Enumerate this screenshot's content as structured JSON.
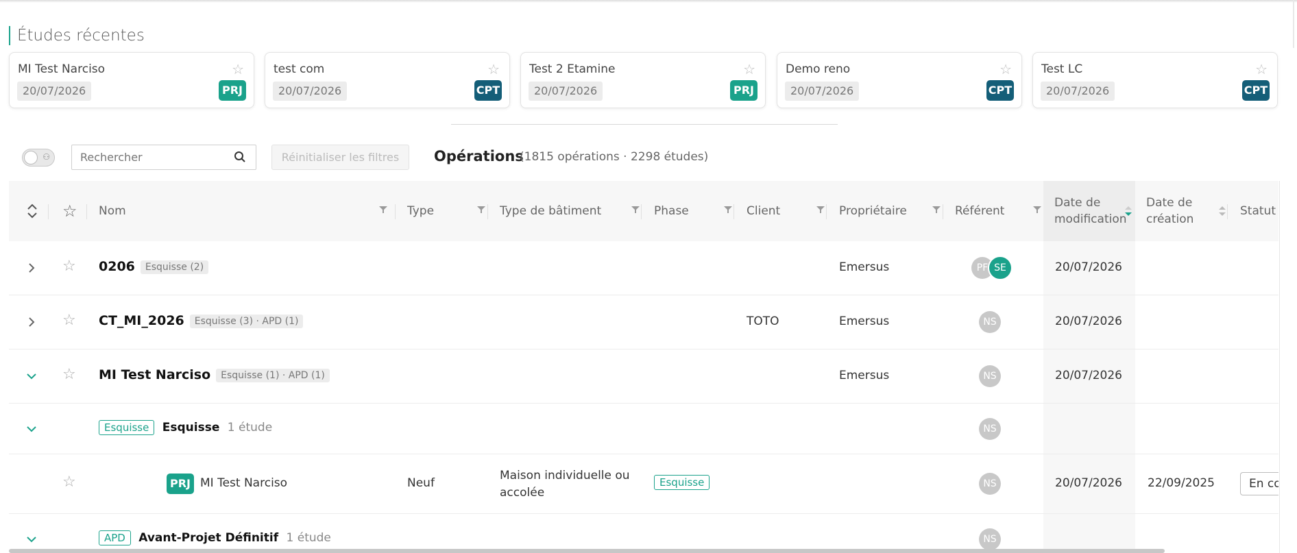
{
  "recent": {
    "title": "Études récentes",
    "cards": [
      {
        "name": "MI Test Narciso",
        "date": "20/07/2026",
        "badge": "PRJ"
      },
      {
        "name": "test com",
        "date": "20/07/2026",
        "badge": "CPT"
      },
      {
        "name": "Test 2 Etamine",
        "date": "20/07/2026",
        "badge": "PRJ"
      },
      {
        "name": "Demo reno",
        "date": "20/07/2026",
        "badge": "CPT"
      },
      {
        "name": "Test LC",
        "date": "20/07/2026",
        "badge": "CPT"
      }
    ]
  },
  "toolbar": {
    "search_placeholder": "Rechercher",
    "reset_label": "Réinitialiser les filtres",
    "title": "Opérations",
    "count": "(1815 opérations · 2298 études)"
  },
  "columns": {
    "nom": "Nom",
    "type": "Type",
    "type_batiment": "Type de bâtiment",
    "phase": "Phase",
    "client": "Client",
    "proprietaire": "Propriétaire",
    "referent": "Référent",
    "date_modif_1": "Date de",
    "date_modif_2": "modification",
    "date_creation_1": "Date de",
    "date_creation_2": "création",
    "statut": "Statut c"
  },
  "rows": [
    {
      "name": "0206",
      "tag": "Esquisse (2)",
      "client": "",
      "owner": "Emersus",
      "avatars": [
        "PF",
        "SE"
      ],
      "modified": "20/07/2026"
    },
    {
      "name": "CT_MI_2026",
      "tag": "Esquisse (3) · APD (1)",
      "client": "TOTO",
      "owner": "Emersus",
      "avatars": [
        "NS"
      ],
      "modified": "20/07/2026"
    },
    {
      "name": "MI Test Narciso",
      "tag": "Esquisse (1) · APD (1)",
      "client": "",
      "owner": "Emersus",
      "avatars": [
        "NS"
      ],
      "modified": "20/07/2026"
    }
  ],
  "phase_esquisse": {
    "tag": "Esquisse",
    "label": "Esquisse",
    "count": "1 étude",
    "avatar": "NS"
  },
  "study": {
    "badge": "PRJ",
    "name": "MI Test Narciso",
    "type": "Neuf",
    "building_1": "Maison individuelle ou",
    "building_2": "accolée",
    "phase": "Esquisse",
    "avatar": "NS",
    "modified": "20/07/2026",
    "created": "22/09/2025",
    "status": "En co"
  },
  "phase_apd": {
    "tag": "APD",
    "label": "Avant-Projet Définitif",
    "count": "1 étude",
    "avatar": "NS"
  },
  "colors": {
    "accent": "#1aa28b",
    "cpt": "#145e78",
    "grey_avatar": "#c8c8c8"
  }
}
